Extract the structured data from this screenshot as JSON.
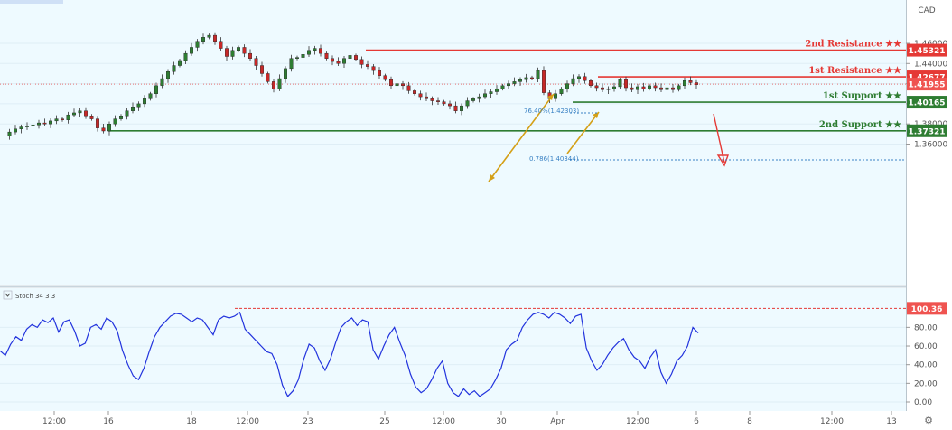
{
  "chart_data": {
    "type": "candlestick",
    "axis_unit": "CAD",
    "price_axis": {
      "ylim": [
        1.35,
        1.475
      ],
      "ticks": [
        "1.46000",
        "1.44000",
        "1.42000",
        "1.40000",
        "1.38000",
        "1.36000"
      ]
    },
    "time_axis": {
      "ticks": [
        "12:00",
        "16",
        "18",
        "12:00",
        "23",
        "25",
        "12:00",
        "30",
        "Apr",
        "12:00",
        "6",
        "8",
        "12:00",
        "13"
      ]
    },
    "current_price": 1.41955,
    "current_price_label": "1.41955",
    "levels": [
      {
        "name": "2nd Resistance ★★",
        "price": 1.45321,
        "price_label": "1.45321",
        "color": "#e53935"
      },
      {
        "name": "1st Resistance ★★",
        "price": 1.42677,
        "price_label": "1.42677",
        "color": "#e53935"
      },
      {
        "name": "1st Support ★★",
        "price": 1.40165,
        "price_label": "1.40165",
        "color": "#2e7d32"
      },
      {
        "name": "2nd Support ★★",
        "price": 1.37321,
        "price_label": "1.37321",
        "color": "#2e7d32"
      }
    ],
    "fib_labels": [
      "76.40%(1.42303)",
      "0.786(1.40344)"
    ],
    "price_series": [
      1.368,
      1.372,
      1.375,
      1.377,
      1.378,
      1.379,
      1.381,
      1.38,
      1.383,
      1.385,
      1.384,
      1.389,
      1.391,
      1.393,
      1.388,
      1.385,
      1.376,
      1.373,
      1.38,
      1.385,
      1.388,
      1.393,
      1.397,
      1.4,
      1.405,
      1.41,
      1.418,
      1.425,
      1.432,
      1.438,
      1.443,
      1.45,
      1.456,
      1.462,
      1.466,
      1.468,
      1.462,
      1.455,
      1.447,
      1.453,
      1.456,
      1.45,
      1.445,
      1.438,
      1.43,
      1.422,
      1.415,
      1.425,
      1.435,
      1.445,
      1.446,
      1.449,
      1.453,
      1.455,
      1.45,
      1.445,
      1.442,
      1.44,
      1.445,
      1.448,
      1.444,
      1.439,
      1.437,
      1.433,
      1.428,
      1.424,
      1.418,
      1.42,
      1.418,
      1.413,
      1.41,
      1.407,
      1.405,
      1.403,
      1.402,
      1.4,
      1.398,
      1.393,
      1.398,
      1.403,
      1.405,
      1.407,
      1.41,
      1.412,
      1.415,
      1.418,
      1.42,
      1.422,
      1.424,
      1.426,
      1.425,
      1.433,
      1.411,
      1.405,
      1.41,
      1.415,
      1.42,
      1.425,
      1.427,
      1.423,
      1.418,
      1.416,
      1.414,
      1.415,
      1.417,
      1.424,
      1.416,
      1.414,
      1.417,
      1.415,
      1.418,
      1.416,
      1.414,
      1.416,
      1.414,
      1.418,
      1.423,
      1.421,
      1.419
    ],
    "indicator": {
      "name": "Stoch 34 3 3",
      "ylim": [
        -5,
        108
      ],
      "ticks": [
        "80.00",
        "60.00",
        "40.00",
        "20.00",
        "0.00"
      ],
      "max_level": 100.36,
      "max_label": "100.36",
      "values": [
        55,
        50,
        62,
        70,
        66,
        78,
        83,
        80,
        88,
        85,
        90,
        75,
        86,
        88,
        76,
        60,
        63,
        80,
        83,
        78,
        90,
        86,
        76,
        55,
        40,
        28,
        24,
        36,
        54,
        70,
        80,
        86,
        92,
        95,
        94,
        90,
        86,
        90,
        88,
        80,
        72,
        88,
        92,
        90,
        92,
        96,
        78,
        72,
        66,
        60,
        54,
        52,
        40,
        18,
        6,
        12,
        24,
        46,
        62,
        58,
        44,
        34,
        46,
        64,
        80,
        86,
        90,
        82,
        88,
        86,
        56,
        46,
        60,
        72,
        80,
        64,
        50,
        30,
        16,
        10,
        14,
        24,
        36,
        44,
        20,
        10,
        6,
        14,
        8,
        12,
        6,
        10,
        14,
        24,
        36,
        56,
        62,
        66,
        80,
        88,
        94,
        96,
        94,
        90,
        96,
        94,
        90,
        84,
        92,
        94,
        58,
        44,
        34,
        40,
        50,
        58,
        64,
        68,
        56,
        48,
        44,
        36,
        48,
        56,
        32,
        20,
        30,
        44,
        50,
        60,
        80,
        74
      ]
    }
  }
}
